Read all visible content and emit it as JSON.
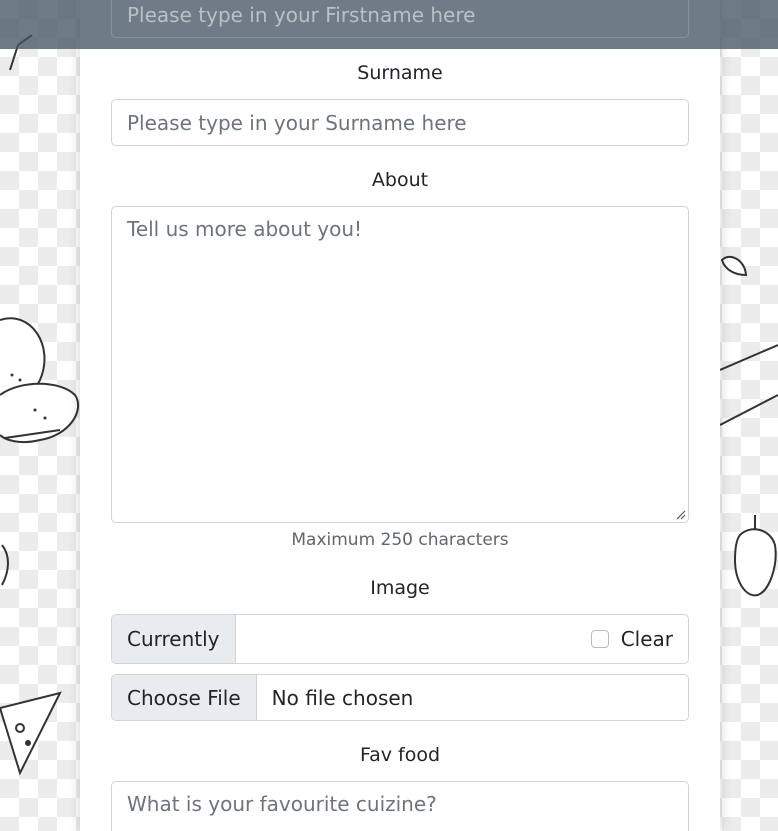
{
  "firstname": {
    "placeholder": "Please type in your Firstname here"
  },
  "surname": {
    "label": "Surname",
    "placeholder": "Please type in your Surname here"
  },
  "about": {
    "label": "About",
    "placeholder": "Tell us more about you!",
    "help": "Maximum 250 characters"
  },
  "image": {
    "label": "Image",
    "currently_label": "Currently",
    "clear_label": "Clear",
    "choose_file_label": "Choose File",
    "file_status": "No file chosen"
  },
  "fav_food": {
    "label": "Fav food",
    "placeholder": "What is your favourite cuizine?"
  },
  "colors": {
    "overlay": "#465664",
    "input_border": "#ced4da",
    "addon_bg": "#e9ecef"
  }
}
